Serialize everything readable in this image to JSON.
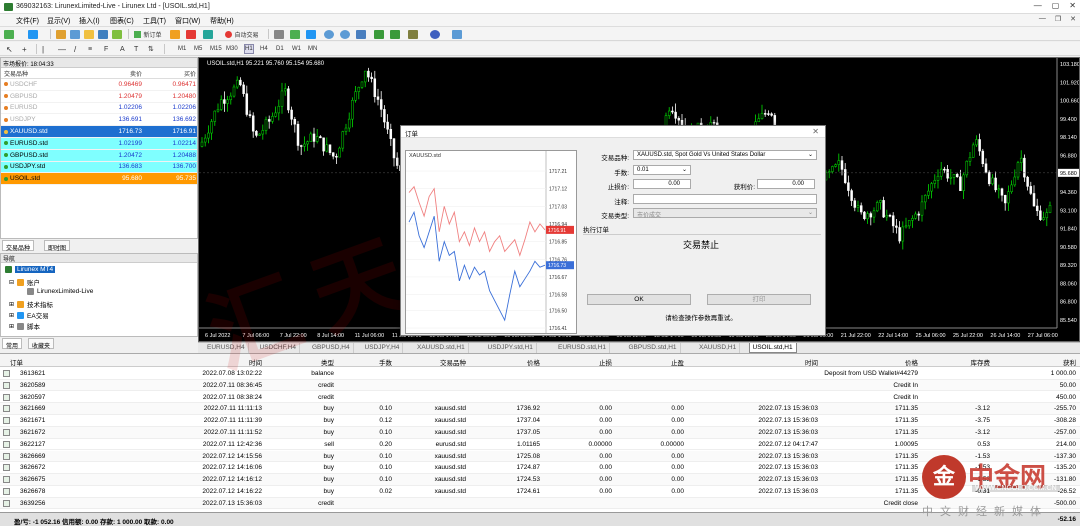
{
  "window": {
    "title": "369032163: LirunexLimited-Live - Lirunex Ltd - [USOIL.std,H1]",
    "controls": [
      "—",
      "▢",
      "✕"
    ]
  },
  "menu": [
    "文件(F)",
    "显示(V)",
    "插入(I)",
    "图表(C)",
    "工具(T)",
    "窗口(W)",
    "帮助(H)"
  ],
  "toolbar": {
    "new_order": "新订单",
    "auto_trade": "自动交易",
    "timeframes": [
      "M1",
      "M5",
      "M15",
      "M30",
      "H1",
      "H4",
      "D1",
      "W1",
      "MN"
    ]
  },
  "market_watch": {
    "header": "市场报价: 18:04:33",
    "columns": [
      "交易品种",
      "卖价",
      "买价"
    ],
    "rows": [
      {
        "symbol": "USDCHF",
        "bid": "0.96469",
        "ask": "0.96471",
        "style": "grey"
      },
      {
        "symbol": "GBPUSD",
        "bid": "1.20479",
        "ask": "1.20480",
        "style": "grey"
      },
      {
        "symbol": "EURUSD",
        "bid": "1.02206",
        "ask": "1.02206",
        "style": "grey"
      },
      {
        "symbol": "USDJPY",
        "bid": "136.691",
        "ask": "136.692",
        "style": "grey"
      },
      {
        "symbol": "XAUUSD.std",
        "bid": "1716.73",
        "ask": "1716.91",
        "style": "selected"
      },
      {
        "symbol": "EURUSD.std",
        "bid": "1.02199",
        "ask": "1.02214",
        "style": "cyan"
      },
      {
        "symbol": "GBPUSD.std",
        "bid": "1.20472",
        "ask": "1.20488",
        "style": "cyan"
      },
      {
        "symbol": "USDJPY.std",
        "bid": "136.683",
        "ask": "136.700",
        "style": "cyan"
      },
      {
        "symbol": "USOIL.std",
        "bid": "95.680",
        "ask": "95.735",
        "style": "orange"
      }
    ],
    "tabs": [
      "交易品种",
      "即时图"
    ]
  },
  "navigator": {
    "header": "导航",
    "items": [
      "Lirunex MT4",
      "账户",
      "LirunexLimited-Live",
      "技术指标",
      "EA交易",
      "脚本"
    ],
    "tabs": [
      "常用",
      "收藏夹"
    ]
  },
  "chart": {
    "label": "USOIL.std,H1 95.221 95.760 95.154 95.680",
    "price_ticks": [
      "103.180",
      "101.920",
      "100.660",
      "99.400",
      "98.140",
      "96.880",
      "95.680",
      "94.360",
      "93.100",
      "91.840",
      "90.580",
      "89.320",
      "88.060",
      "86.800",
      "85.540"
    ],
    "time_ticks": [
      "6 Jul 2022",
      "7 Jul 06:00",
      "7 Jul 22:00",
      "8 Jul 14:00",
      "11 Jul 06:00",
      "11 Jul 22:00",
      "12 Jul 14:00",
      "13 Jul 06:00",
      "13 Jul 22:00",
      "14 Jul 14:00",
      "15 Jul 06:00",
      "15 Jul 22:00",
      "18 Jul 14:00",
      "19 Jul 06:00",
      "19 Jul 22:00",
      "20 Jul 14:00",
      "21 Jul 06:00",
      "21 Jul 22:00",
      "22 Jul 14:00",
      "25 Jul 06:00",
      "25 Jul 22:00",
      "26 Jul 14:00",
      "27 Jul 06:00"
    ],
    "current_price": "95.680",
    "up_color": "#00e000",
    "down_color": "#ffffff"
  },
  "chart_tabs": [
    "EURUSD,H4",
    "USDCHF,H4",
    "GBPUSD,H4",
    "USDJPY,H4",
    "XAUUSD.std,H1",
    "USDJPY.std,H1",
    "EURUSD.std,H1",
    "GBPUSD.std,H1",
    "XAUUSD,H1",
    "USOIL.std,H1"
  ],
  "chart_tab_active": 9,
  "order_dialog": {
    "title": "订单",
    "symbol_label": "交易品种:",
    "symbol_value": "XAUUSD.std, Spot Gold Vs United States Dollar",
    "volume_label": "手数:",
    "volume_value": "0.01",
    "sl_label": "止损价:",
    "sl_value": "0.00",
    "tp_label": "获利价:",
    "tp_value": "0.00",
    "comment_label": "注释:",
    "comment_value": "",
    "type_label": "交易类型:",
    "type_value": "市价成交",
    "section": "执行订单",
    "disabled_msg": "交易禁止",
    "ok": "OK",
    "print": "打印",
    "hint": "请检查操作参数再重试。",
    "mini_title": "XAUUSD.std",
    "mini_ticks": [
      "1717.21",
      "1717.12",
      "1717.03",
      "1716.94",
      "1716.85",
      "1716.76",
      "1716.67",
      "1716.58",
      "1716.50",
      "1716.41"
    ],
    "mini_bid": "1716.73",
    "mini_ask": "1716.91"
  },
  "terminal": {
    "columns": [
      "订单",
      "时间",
      "类型",
      "手数",
      "交易品种",
      "价格",
      "止损",
      "止盈",
      "时间",
      "价格",
      "库存费",
      "获利"
    ],
    "rows": [
      [
        "3613621",
        "2022.07.08 13:02:22",
        "balance",
        "",
        "",
        "",
        "",
        "",
        "",
        "Deposit from USD Wallet#44279",
        "",
        "1 000.00"
      ],
      [
        "3620589",
        "2022.07.11 08:36:45",
        "credit",
        "",
        "",
        "",
        "",
        "",
        "",
        "Credit In",
        "",
        "50.00"
      ],
      [
        "3620597",
        "2022.07.11 08:38:24",
        "credit",
        "",
        "",
        "",
        "",
        "",
        "",
        "Credit In",
        "",
        "450.00"
      ],
      [
        "3621669",
        "2022.07.11 11:11:13",
        "buy",
        "0.10",
        "xauusd.std",
        "1736.92",
        "0.00",
        "0.00",
        "2022.07.13 15:36:03",
        "1711.35",
        "-3.12",
        "-255.70"
      ],
      [
        "3621671",
        "2022.07.11 11:11:39",
        "buy",
        "0.12",
        "xauusd.std",
        "1737.04",
        "0.00",
        "0.00",
        "2022.07.13 15:36:03",
        "1711.35",
        "-3.75",
        "-308.28"
      ],
      [
        "3621672",
        "2022.07.11 11:11:52",
        "buy",
        "0.10",
        "xauusd.std",
        "1737.05",
        "0.00",
        "0.00",
        "2022.07.13 15:36:03",
        "1711.35",
        "-3.12",
        "-257.00"
      ],
      [
        "3622127",
        "2022.07.11 12:42:36",
        "sell",
        "0.20",
        "eurusd.std",
        "1.01165",
        "0.00000",
        "0.00000",
        "2022.07.12 04:17:47",
        "1.00095",
        "0.53",
        "214.00"
      ],
      [
        "3626669",
        "2022.07.12 14:15:56",
        "buy",
        "0.10",
        "xauusd.std",
        "1725.08",
        "0.00",
        "0.00",
        "2022.07.13 15:36:03",
        "1711.35",
        "-1.53",
        "-137.30"
      ],
      [
        "3626672",
        "2022.07.12 14:16:06",
        "buy",
        "0.10",
        "xauusd.std",
        "1724.87",
        "0.00",
        "0.00",
        "2022.07.13 15:36:03",
        "1711.35",
        "-1.53",
        "-135.20"
      ],
      [
        "3626675",
        "2022.07.12 14:16:12",
        "buy",
        "0.10",
        "xauusd.std",
        "1724.53",
        "0.00",
        "0.00",
        "2022.07.13 15:36:03",
        "1711.35",
        "-1.53",
        "-131.80"
      ],
      [
        "3626678",
        "2022.07.12 14:16:22",
        "buy",
        "0.02",
        "xauusd.std",
        "1724.61",
        "0.00",
        "0.00",
        "2022.07.13 15:36:03",
        "1711.35",
        "-0.31",
        "-26.52"
      ],
      [
        "3639256",
        "2022.07.13 15:36:03",
        "credit",
        "",
        "",
        "",
        "",
        "",
        "",
        "Credit close",
        "",
        "-500.00"
      ]
    ],
    "status": "盈/亏: -1 052.16  信用额: 0.00  存款: 1 000.00  取款: 0.00",
    "status_total": "-52.16"
  },
  "brand": {
    "name": "中金网",
    "url": "WWW.CNGOLD.COM.CN",
    "slogan": "中文财经新媒体"
  },
  "watermark": "汇天眼"
}
